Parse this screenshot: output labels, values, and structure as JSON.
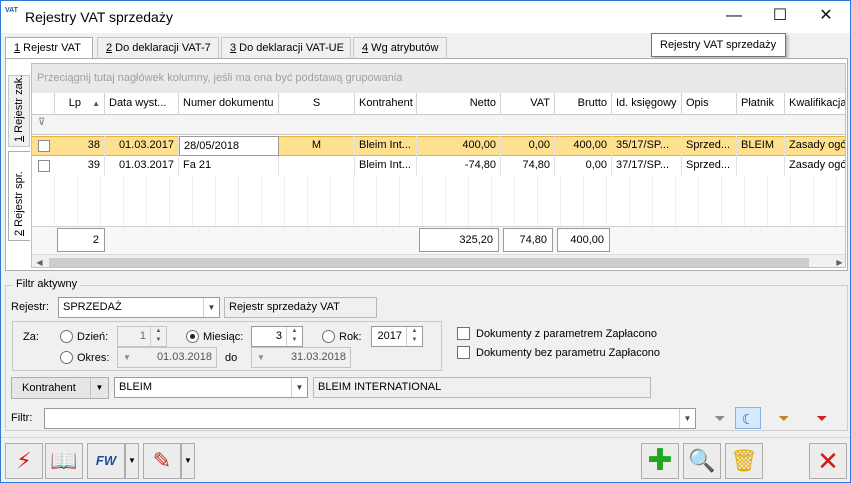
{
  "window": {
    "app_icon_text": "VAT",
    "title": "Rejestry VAT sprzedaży",
    "minimize": "—",
    "maximize": "☐",
    "close": "✕"
  },
  "tabs": [
    {
      "key": "1",
      "label": " Rejestr VAT"
    },
    {
      "key": "2",
      "label": " Do deklaracji VAT-7"
    },
    {
      "key": "3",
      "label": " Do deklaracji VAT-UE"
    },
    {
      "key": "4",
      "label": " Wg atrybutów"
    }
  ],
  "tooltip": "Rejestry VAT sprzedaży",
  "side_tabs": [
    {
      "key": "1",
      "label": " Rejestr zak."
    },
    {
      "key": "2",
      "label": " Rejestr spr."
    }
  ],
  "grid": {
    "group_hint": "Przeciągnij tutaj nagłówek kolumny, jeśli ma ona być podstawą grupowania",
    "columns": [
      "Lp",
      "Data wyst...",
      "Numer dokumentu",
      "S",
      "Kontrahent",
      "Netto",
      "VAT",
      "Brutto",
      "Id. księgowy",
      "Opis",
      "Płatnik",
      "Kwalifikacja"
    ],
    "sort_indicator": "▲",
    "filter_icon": "⊽",
    "rows": [
      {
        "lp": "38",
        "data": "01.03.2017",
        "numer": "28/05/2018",
        "s": "M",
        "kontrahent": "Bleim Int...",
        "netto": "400,00",
        "vat": "0,00",
        "brutto": "400,00",
        "id": "35/17/SP...",
        "opis": "Sprzed...",
        "platnik": "BLEIM",
        "kwalifikacja": "Zasady ogó"
      },
      {
        "lp": "39",
        "data": "01.03.2017",
        "numer": "Fa 21",
        "s": "",
        "kontrahent": "Bleim Int...",
        "netto": "-74,80",
        "vat": "74,80",
        "brutto": "0,00",
        "id": "37/17/SP...",
        "opis": "Sprzed...",
        "platnik": "",
        "kwalifikacja": "Zasady ogó"
      }
    ],
    "summary": {
      "count": "2",
      "netto": "325,20",
      "vat": "74,80",
      "brutto": "400,00"
    },
    "scroll_left": "◀",
    "scroll_right": "▶"
  },
  "filter": {
    "legend": "Filtr aktywny",
    "rejestr_label": "Rejestr:",
    "rejestr_value": "SPRZEDAŻ",
    "rejestr_desc": "Rejestr sprzedaży VAT",
    "za_label": "Za:",
    "dzien_label": "Dzień:",
    "dzien_value": "1",
    "miesiac_label": "Miesiąc:",
    "miesiac_value": "3",
    "rok_label": "Rok:",
    "rok_value": "2017",
    "okres_label": "Okres:",
    "okres_from": "01.03.2018",
    "do_label": "do",
    "okres_to": "31.03.2018",
    "cb_zaplacono": "Dokumenty z parametrem Zapłacono",
    "cb_bez_zaplacono": "Dokumenty bez parametru Zapłacono",
    "kontrahent_button": "Kontrahent",
    "kontrahent_value": "BLEIM",
    "kontrahent_name": "BLEIM INTERNATIONAL",
    "filtr_label": "Filtr:",
    "filtr_value": ""
  },
  "toolbar": {
    "fw_label": "FW"
  }
}
